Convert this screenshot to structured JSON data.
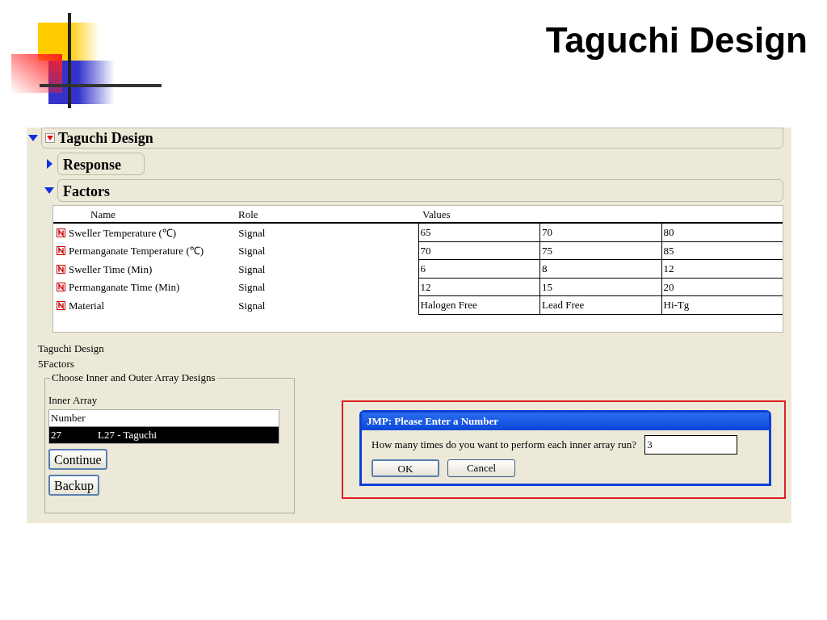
{
  "slide_title": "Taguchi Design",
  "report": {
    "title": "Taguchi Design",
    "expanded": true,
    "sections": [
      {
        "title": "Response",
        "expanded": false
      },
      {
        "title": "Factors",
        "expanded": true
      }
    ]
  },
  "factors_table": {
    "columns": [
      "Name",
      "Role",
      "Values"
    ],
    "rows": [
      {
        "name": "Sweller Temperature (℃)",
        "role": "Signal",
        "values": [
          "65",
          "70",
          "80"
        ]
      },
      {
        "name": "Permanganate Temperature (℃)",
        "role": "Signal",
        "values": [
          "70",
          "75",
          "85"
        ]
      },
      {
        "name": "Sweller Time (Min)",
        "role": "Signal",
        "values": [
          "6",
          "8",
          "12"
        ]
      },
      {
        "name": "Permanganate Time  (Min)",
        "role": "Signal",
        "values": [
          "12",
          "15",
          "20"
        ]
      },
      {
        "name": "Material",
        "role": "Signal",
        "values": [
          "Halogen Free",
          "Lead Free",
          "Hi-Tg"
        ]
      }
    ]
  },
  "design_label": "Taguchi Design",
  "factor_count": "5Factors",
  "array_group": {
    "legend": "Choose Inner and Outer Array Designs",
    "list_label": "Inner Array",
    "list_header": "Number",
    "items": [
      {
        "number": "27",
        "name": "L27 - Taguchi",
        "selected": true
      }
    ],
    "buttons": [
      "Continue",
      "Backup"
    ]
  },
  "dialog": {
    "title": "JMP: Please Enter a Number",
    "prompt": "How many times do you want to perform each inner array run?",
    "value": "3",
    "buttons": [
      "OK",
      "Cancel"
    ]
  }
}
